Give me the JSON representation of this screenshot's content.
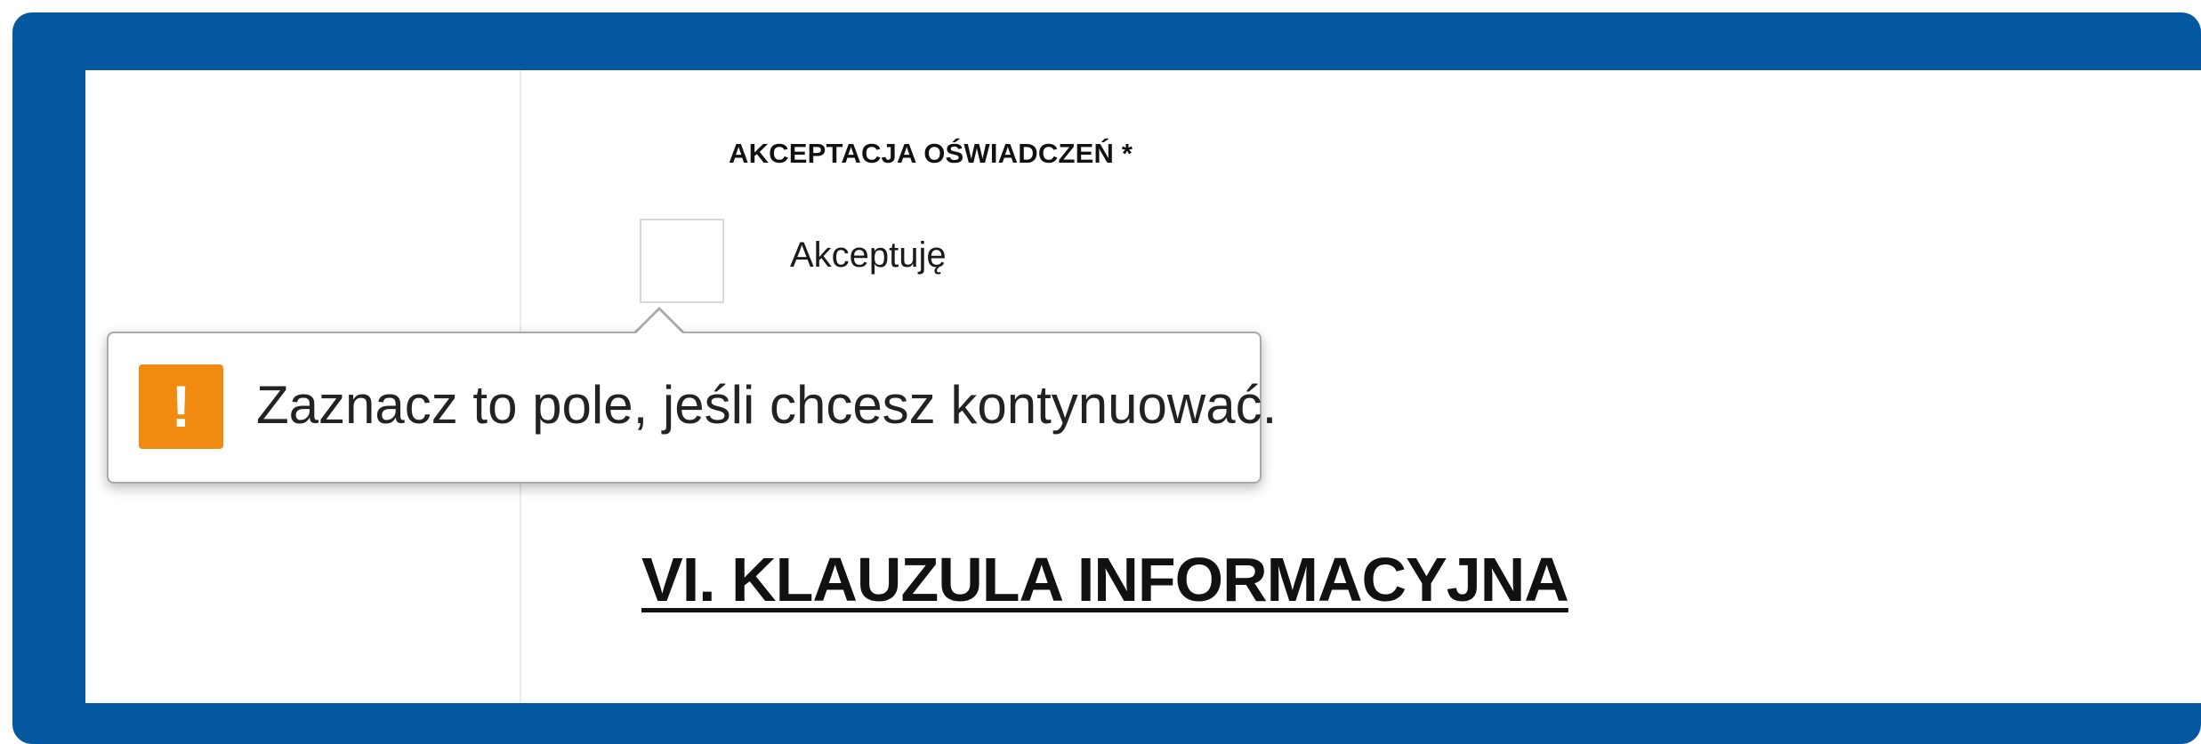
{
  "form": {
    "section_label": "AKCEPTACJA OŚWIADCZEŃ *",
    "checkbox_label": "Akceptuję",
    "checkbox_checked": false
  },
  "validation_tooltip": {
    "icon": "warning-exclamation-icon",
    "icon_color": "#f08a10",
    "message": "Zaznacz to pole, jeśli chcesz kontynuować."
  },
  "next_section": {
    "heading": "VI. KLAUZULA INFORMACYJNA"
  },
  "theme": {
    "frame_color": "#03589f"
  }
}
